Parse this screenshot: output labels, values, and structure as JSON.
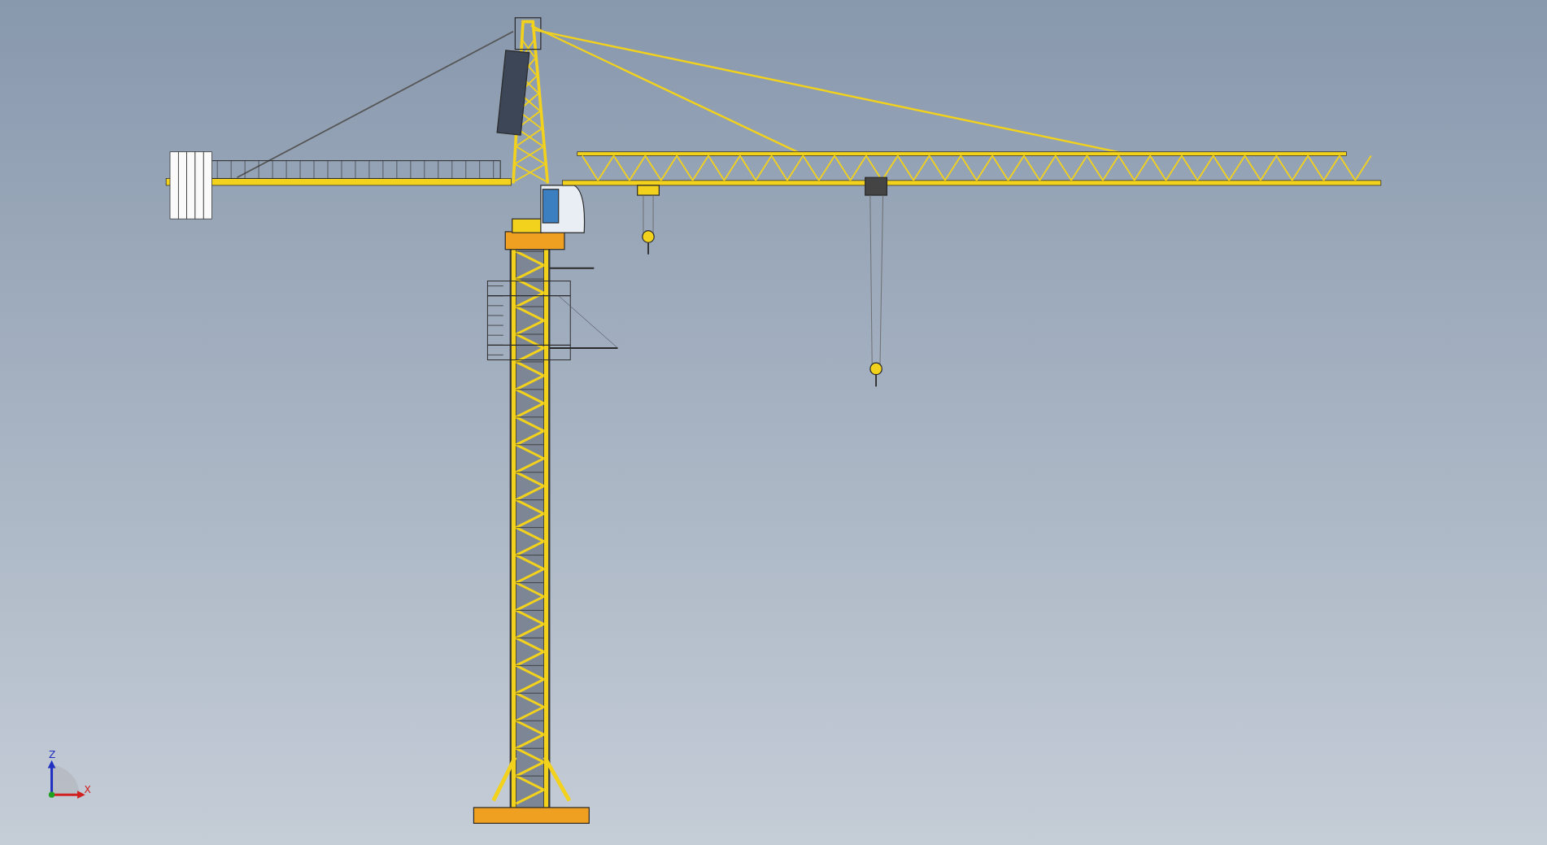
{
  "viewport": {
    "axis_triad": {
      "labels": [
        "Z",
        "X"
      ]
    }
  }
}
